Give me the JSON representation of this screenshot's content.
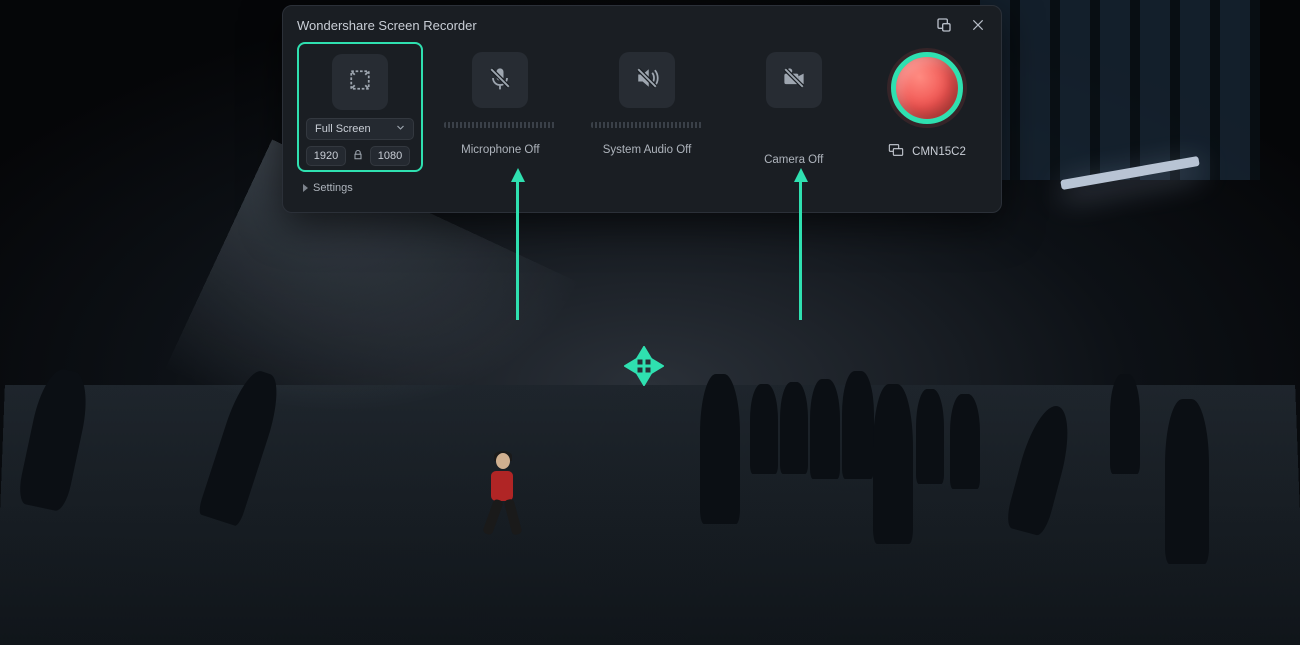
{
  "app": {
    "title": "Wondershare Screen Recorder"
  },
  "screen": {
    "mode_label": "Full Screen",
    "width": "1920",
    "height": "1080"
  },
  "mic": {
    "label": "Microphone Off"
  },
  "audio": {
    "label": "System Audio Off"
  },
  "camera": {
    "label": "Camera Off"
  },
  "display": {
    "name": "CMN15C2"
  },
  "settings": {
    "label": "Settings"
  },
  "colors": {
    "accent": "#2fe0b0",
    "record": "#ef5350",
    "panel": "#1a1e23"
  }
}
